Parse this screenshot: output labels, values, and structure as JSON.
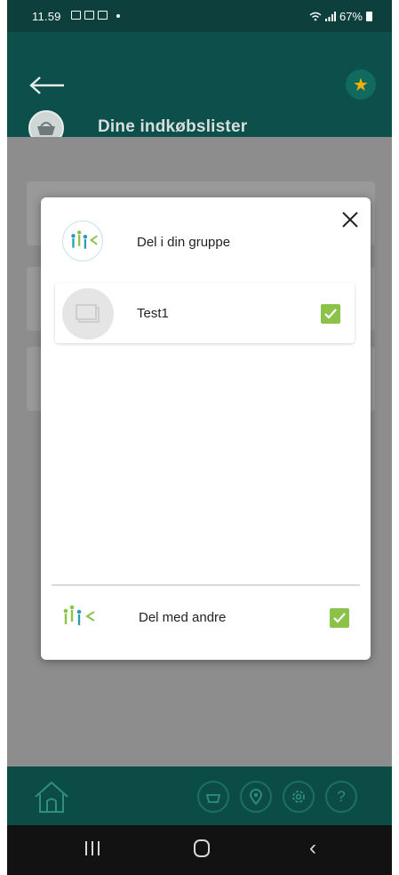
{
  "status_bar": {
    "time": "11.59",
    "battery": "67%"
  },
  "header": {
    "title": "Dine indkøbslister",
    "star_icon": "★"
  },
  "dialog": {
    "group_title": "Del i din gruppe",
    "list_items": [
      {
        "label": "Test1",
        "checked": true
      }
    ],
    "share_label": "Del med andre",
    "share_checked": true
  },
  "bottom_bar": {
    "buttons": [
      {
        "icon": "basket-icon"
      },
      {
        "icon": "location-pin-icon"
      },
      {
        "icon": "settings-gear-icon"
      },
      {
        "icon": "help-icon",
        "glyph": "?"
      }
    ]
  },
  "colors": {
    "header_bg": "#0d4f4a",
    "accent_green": "#8bc24a",
    "star": "#f2b100",
    "bottom_bar": "#0c4c47"
  }
}
